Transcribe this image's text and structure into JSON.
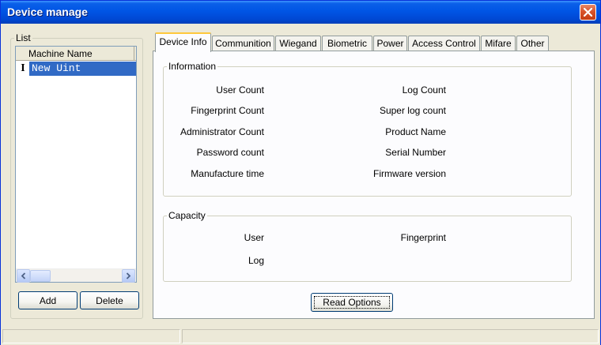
{
  "window": {
    "title": "Device manage"
  },
  "list_group": {
    "label": "List",
    "column_header": "Machine Name",
    "rows": [
      {
        "icon": "text-cursor-icon",
        "icon_glyph": "I",
        "label": "New Uint"
      }
    ]
  },
  "buttons": {
    "add": "Add",
    "delete": "Delete",
    "read_options": "Read Options"
  },
  "tabs": [
    "Device Info",
    "Communition",
    "Wiegand",
    "Biometric",
    "Power",
    "Access Control",
    "Mifare",
    "Other"
  ],
  "active_tab": "Device Info",
  "information": {
    "label": "Information",
    "left_fields": [
      "User Count",
      "Fingerprint Count",
      "Administrator Count",
      "Password count",
      "Manufacture time"
    ],
    "right_fields": [
      "Log Count",
      "Super log count",
      "Product Name",
      "Serial Number",
      "Firmware version"
    ]
  },
  "capacity": {
    "label": "Capacity",
    "left_fields": [
      "User",
      "Log"
    ],
    "right_fields": [
      "Fingerprint"
    ]
  },
  "colors": {
    "titlebar": "#0055e5",
    "selection": "#316ac5",
    "active_tab_highlight": "#ffc83c"
  }
}
